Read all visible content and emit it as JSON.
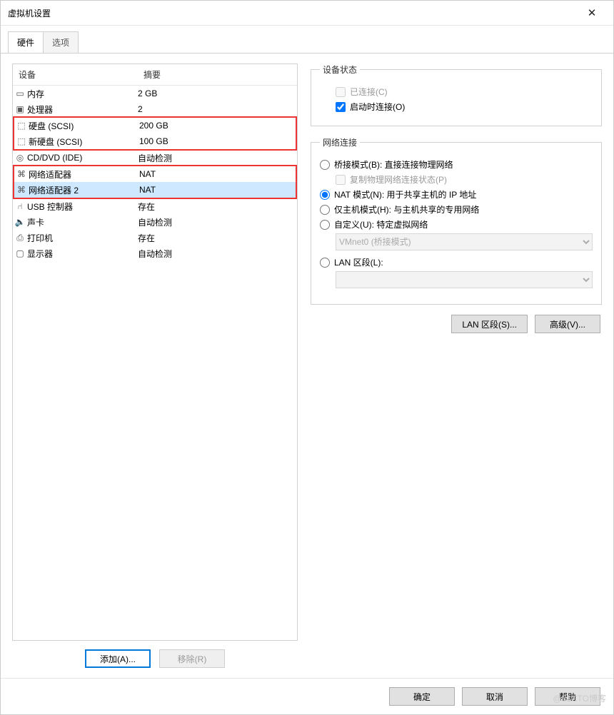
{
  "window": {
    "title": "虚拟机设置"
  },
  "tabs": {
    "hardware": "硬件",
    "options": "选项"
  },
  "columns": {
    "device": "设备",
    "summary": "摘要"
  },
  "devices": [
    {
      "icon": "▭",
      "name": "内存",
      "summary": "2 GB"
    },
    {
      "icon": "▣",
      "name": "处理器",
      "summary": "2"
    },
    {
      "icon": "⬚",
      "name": "硬盘 (SCSI)",
      "summary": "200 GB"
    },
    {
      "icon": "⬚",
      "name": "新硬盘 (SCSI)",
      "summary": "100 GB"
    },
    {
      "icon": "◎",
      "name": "CD/DVD (IDE)",
      "summary": "自动检测"
    },
    {
      "icon": "⌘",
      "name": "网络适配器",
      "summary": "NAT"
    },
    {
      "icon": "⌘",
      "name": "网络适配器 2",
      "summary": "NAT"
    },
    {
      "icon": "⑁",
      "name": "USB 控制器",
      "summary": "存在"
    },
    {
      "icon": "🔈",
      "name": "声卡",
      "summary": "自动检测"
    },
    {
      "icon": "⎙",
      "name": "打印机",
      "summary": "存在"
    },
    {
      "icon": "▢",
      "name": "显示器",
      "summary": "自动检测"
    }
  ],
  "buttons": {
    "add": "添加(A)...",
    "remove": "移除(R)",
    "lan": "LAN 区段(S)...",
    "advanced": "高级(V)...",
    "ok": "确定",
    "cancel": "取消",
    "help": "帮助"
  },
  "status_group": {
    "legend": "设备状态",
    "connected": "已连接(C)",
    "connect_on_start": "启动时连接(O)"
  },
  "net_group": {
    "legend": "网络连接",
    "bridge": "桥接模式(B): 直接连接物理网络",
    "replicate": "复制物理网络连接状态(P)",
    "nat": "NAT 模式(N): 用于共享主机的 IP 地址",
    "hostonly": "仅主机模式(H): 与主机共享的专用网络",
    "custom": "自定义(U): 特定虚拟网络",
    "vmnet_option": "VMnet0 (桥接模式)",
    "lan": "LAN 区段(L):"
  },
  "watermark": "@51CTO博客"
}
